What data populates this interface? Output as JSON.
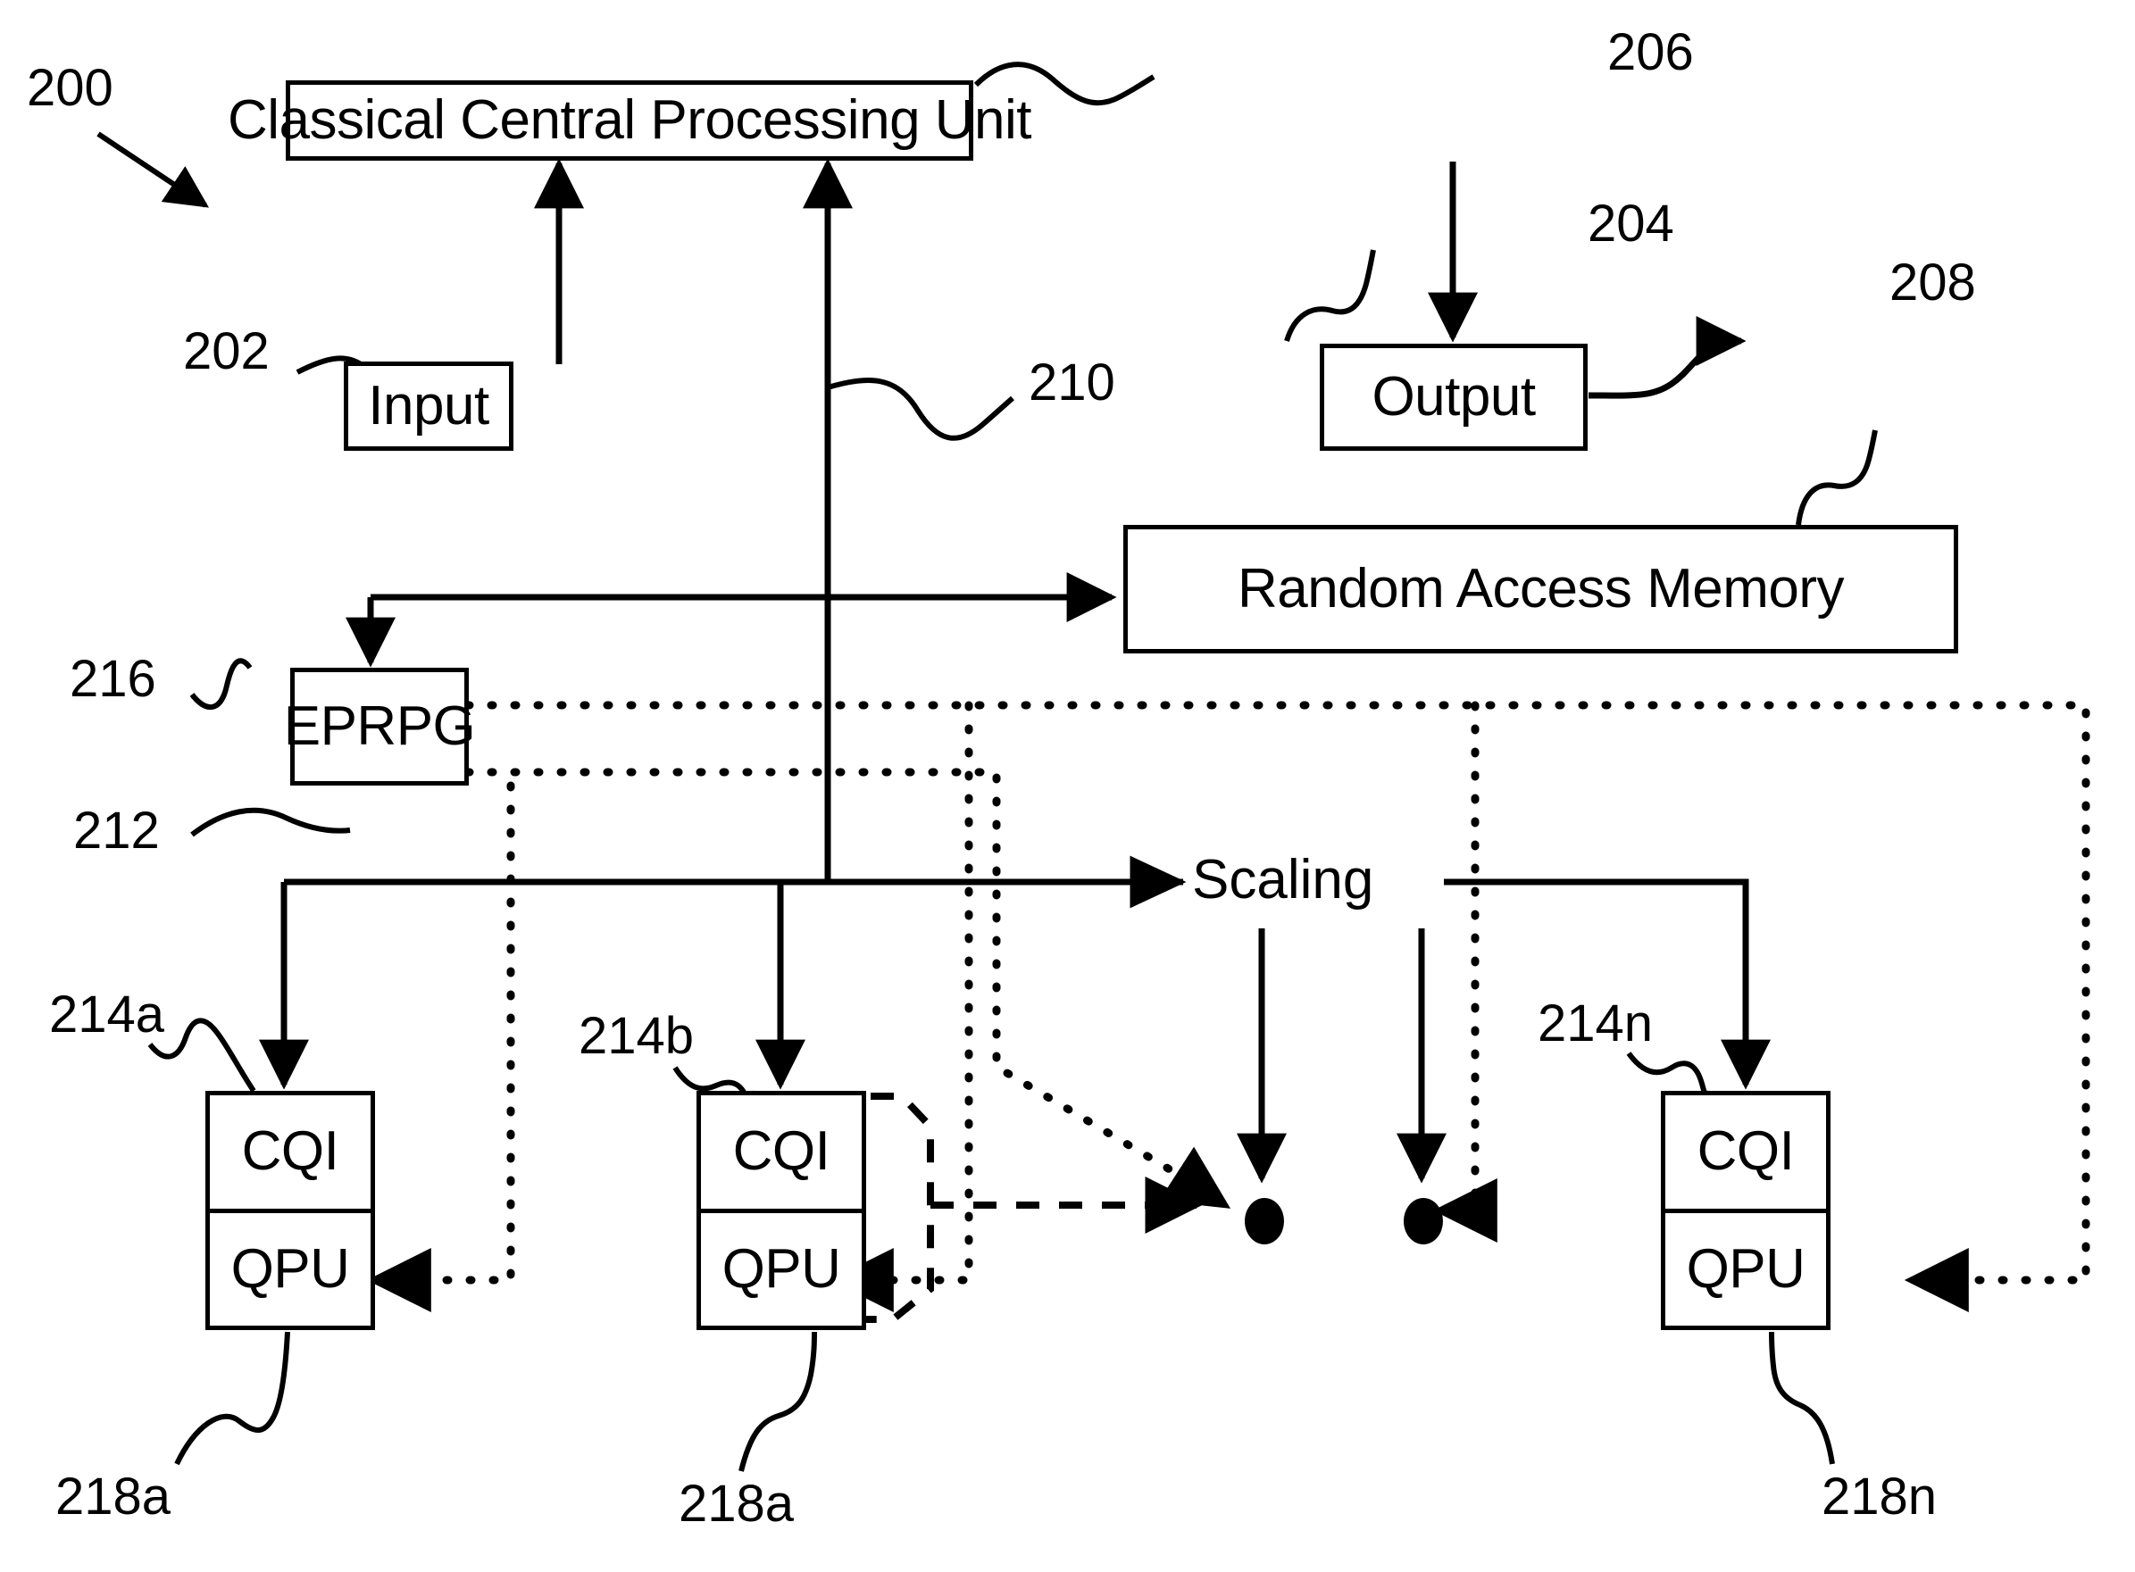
{
  "figure": {
    "id": "200",
    "type": "patent-block-diagram"
  },
  "blocks": {
    "cpu": {
      "label": "Classical Central Processing Unit",
      "ref": "206"
    },
    "input": {
      "label": "Input",
      "ref": "202"
    },
    "output": {
      "label": "Output",
      "ref": "204"
    },
    "ram": {
      "label": "Random Access Memory",
      "ref": "208"
    },
    "eprpg": {
      "label": "EPRPG",
      "ref": "216"
    },
    "scaling": {
      "label": "Scaling"
    },
    "qpu_a": {
      "top": "CQI",
      "bottom": "QPU",
      "ref": "214a",
      "tail_ref": "218a"
    },
    "qpu_b": {
      "top": "CQI",
      "bottom": "QPU",
      "ref": "214b",
      "tail_ref": "218a"
    },
    "qpu_n": {
      "top": "CQI",
      "bottom": "QPU",
      "ref": "214n",
      "tail_ref": "218n"
    }
  },
  "reference_numerals": {
    "figure": "200",
    "input": "202",
    "output": "204",
    "cpu": "206",
    "ram": "208",
    "bus": "210",
    "bus_lower": "212",
    "qpu_unit_a": "214a",
    "qpu_unit_b": "214b",
    "qpu_unit_n": "214n",
    "eprpg": "216",
    "tail_a": "218a",
    "tail_b": "218a",
    "tail_n": "218n"
  },
  "colors": {
    "stroke": "#000000",
    "background": "#ffffff"
  }
}
